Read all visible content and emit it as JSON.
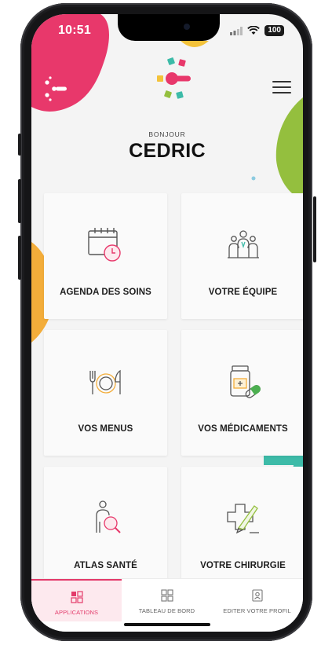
{
  "status_bar": {
    "time": "10:51",
    "battery": "100"
  },
  "header": {
    "greeting_small": "BONJOUR",
    "user_name": "CEDRIC"
  },
  "cards": [
    {
      "label": "AGENDA DES SOINS",
      "icon": "calendar-clock-icon"
    },
    {
      "label": "VOTRE ÉQUIPE",
      "icon": "team-icon"
    },
    {
      "label": "VOS MENUS",
      "icon": "plate-cutlery-icon"
    },
    {
      "label": "VOS MÉDICAMENTS",
      "icon": "medication-icon"
    },
    {
      "label": "ATLAS SANTÉ",
      "icon": "body-search-icon"
    },
    {
      "label": "VOTRE CHIRURGIE",
      "icon": "surgery-icon"
    }
  ],
  "tabbar": {
    "tabs": [
      {
        "label": "APPLICATIONS",
        "icon": "apps-icon",
        "active": true
      },
      {
        "label": "TABLEAU DE BORD",
        "icon": "dashboard-icon",
        "active": false
      },
      {
        "label": "EDITER VOTRE PROFIL",
        "icon": "profile-icon",
        "active": false
      }
    ]
  },
  "colors": {
    "accent_pink": "#e33a6a",
    "green": "#94bf3e",
    "orange": "#f3ad3a",
    "teal": "#3dbba8"
  }
}
